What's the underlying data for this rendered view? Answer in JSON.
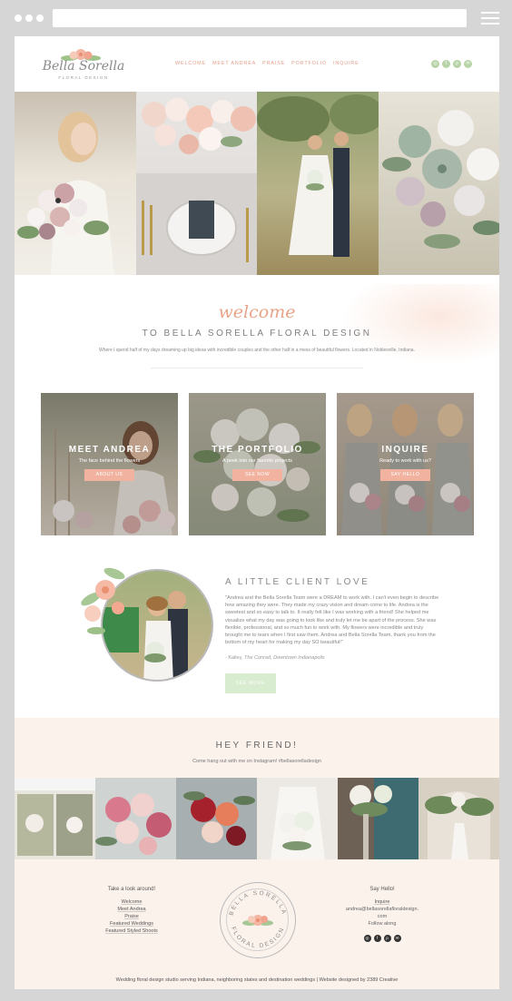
{
  "header": {
    "logo_script": "Bella Sorella",
    "logo_sub": "FLORAL DESIGN",
    "nav": [
      "WELCOME",
      "MEET ANDREA",
      "PRAISE",
      "PORTFOLIO",
      "INQUIRE"
    ],
    "social_icons": [
      "instagram-icon",
      "facebook-icon",
      "pinterest-icon",
      "email-icon"
    ]
  },
  "welcome": {
    "script": "welcome",
    "title": "TO BELLA SORELLA FLORAL DESIGN",
    "text": "Where I spend half of my days dreaming up big ideas with incredible couples and the other half in a mess of beautiful flowers. Located in Noblesville, Indiana."
  },
  "cards": [
    {
      "title": "MEET ANDREA",
      "subtitle": "The face behind the flowers",
      "button": "ABOUT US"
    },
    {
      "title": "THE PORTFOLIO",
      "subtitle": "A peek into our favorite projects",
      "button": "SEE NOW"
    },
    {
      "title": "INQUIRE",
      "subtitle": "Ready to work with us?",
      "button": "SAY HELLO"
    }
  ],
  "testimonial": {
    "title": "A LITTLE CLIENT LOVE",
    "quote": "\"Andrea and the Bella Sorella Team were a DREAM to work with. I can't even begin to describe how amazing they were.  They made my crazy vision and dream come to life. Andrea is the sweetest and so easy to talk to. It really felt like I was working with a friend! She helped me visualize what my day was going to look like and truly let me be apart of the process. She was flexible, professional, and so much fun to work with. My flowers were incredible and truly brought me to tears when I first saw them. Andrea and Bella Sorella Team, thank you from the bottom of my heart for making my day SO beautiful!\"",
    "cite_name": "- Kailey,",
    "cite_place": "The Conrad, Downtown Indianapolis",
    "button": "SEE MORE"
  },
  "hey": {
    "title": "HEY FRIEND!",
    "subtitle": "Come hang out with me on Instagram! #bellasorelladesign"
  },
  "footer": {
    "left_head": "Take a look around!",
    "left_links": [
      "Welcome",
      "Meet Andrea",
      "Praise",
      "Featured Weddings",
      "Featured Styled Shoots"
    ],
    "seal_top": "BELLA SORELLA",
    "seal_bottom": "FLORAL DESIGN",
    "right_head": "Say Hello!",
    "right_link": "Inquire",
    "email_line1": "andrea@bellasorellafloraldesign.",
    "email_line2": "com",
    "follow": "Follow along",
    "bottom": "Wedding floral design studio serving Indiana, neighboring states and destination weddings  |  Website designed by 2389 Creative"
  },
  "colors": {
    "accent": "#e3a08b",
    "button_pink": "#f2b2a0",
    "button_green": "#d8eccf",
    "blush_bg": "#fcf2ec"
  }
}
